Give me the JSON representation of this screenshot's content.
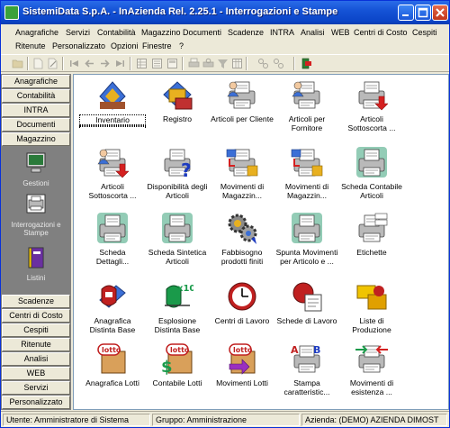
{
  "window": {
    "title": "SistemiData S.p.A. - InAzienda Rel. 2.25.1 - Interrogazioni e Stampe"
  },
  "menu": {
    "row1": [
      "Anagrafiche",
      "Servizi",
      "Contabilità",
      "Magazzino",
      "Documenti",
      "Scadenze",
      "INTRA",
      "Analisi",
      "WEB",
      "Centri di Costo",
      "Cespiti"
    ],
    "row2": [
      "Ritenute",
      "Personalizzato",
      "Opzioni",
      "Finestre",
      "?"
    ]
  },
  "sidebar": {
    "top_buttons": [
      "Anagrafiche",
      "Contabilità",
      "INTRA",
      "Documenti",
      "Magazzino"
    ],
    "items": [
      "Gestioni",
      "Interrogazioni e Stampe",
      "Listini"
    ],
    "bottom_buttons": [
      "Scadenze",
      "Centri di Costo",
      "Cespiti",
      "Ritenute",
      "Analisi",
      "WEB",
      "Servizi",
      "Personalizzato"
    ]
  },
  "items": [
    {
      "line1": "Inventario",
      "line2": "",
      "icon": "inventory-icon"
    },
    {
      "line1": "Registro",
      "line2": "",
      "icon": "register-icon"
    },
    {
      "line1": "Articoli per Cliente",
      "line2": "",
      "icon": "printer-person-icon"
    },
    {
      "line1": "Articoli per",
      "line2": "Fornitore",
      "icon": "printer-person-icon"
    },
    {
      "line1": "Articoli",
      "line2": "Sottoscorta ...",
      "icon": "printer-arrow-icon"
    },
    {
      "line1": "Articoli",
      "line2": "Sottoscorta ...",
      "icon": "printer-person-arrow-icon"
    },
    {
      "line1": "Disponibilità degli",
      "line2": "Articoli",
      "icon": "printer-question-icon"
    },
    {
      "line1": "Movimenti di",
      "line2": "Magazzin...",
      "icon": "printer-boxes-icon"
    },
    {
      "line1": "Movimenti di",
      "line2": "Magazzin...",
      "icon": "printer-boxes-icon"
    },
    {
      "line1": "Scheda Contabile",
      "line2": "Articoli",
      "icon": "printer-green-icon"
    },
    {
      "line1": "Scheda",
      "line2": "Dettagli...",
      "icon": "printer-green-icon"
    },
    {
      "line1": "Scheda Sintetica",
      "line2": "Articoli",
      "icon": "printer-green-icon"
    },
    {
      "line1": "Fabbisogno",
      "line2": "prodotti finiti",
      "icon": "gears-icon"
    },
    {
      "line1": "Spunta Movimenti",
      "line2": "per Articolo e ...",
      "icon": "printer-green-icon"
    },
    {
      "line1": "Etichette",
      "line2": "",
      "icon": "printer-labels-icon"
    },
    {
      "line1": "Anagrafica",
      "line2": "Distinta Base",
      "icon": "bom-icon"
    },
    {
      "line1": "Esplosione",
      "line2": "Distinta Base",
      "icon": "bom-explode-icon"
    },
    {
      "line1": "Centri di Lavoro",
      "line2": "",
      "icon": "clock-icon"
    },
    {
      "line1": "Schede di Lavoro",
      "line2": "",
      "icon": "workcard-icon"
    },
    {
      "line1": "Liste di",
      "line2": "Produzione",
      "icon": "production-icon"
    },
    {
      "line1": "Anagrafica Lotti",
      "line2": "",
      "icon": "lotto-icon"
    },
    {
      "line1": "Contabile Lotti",
      "line2": "",
      "icon": "lotto-money-icon"
    },
    {
      "line1": "Movimenti Lotti",
      "line2": "",
      "icon": "lotto-arrow-icon"
    },
    {
      "line1": "Stampa",
      "line2": "caratteristic...",
      "icon": "printer-letters-icon"
    },
    {
      "line1": "Movimenti di",
      "line2": "esistenza ...",
      "icon": "printer-arrows-icon"
    }
  ],
  "status": {
    "user": "Utente: Amministratore di Sistema",
    "group": "Gruppo: Amministrazione",
    "company": "Azienda: (DEMO) AZIENDA DIMOST"
  },
  "colors": {
    "title_bar": "#0b45c8",
    "sidebar_bg": "#808080",
    "accent_red": "#d42020",
    "accent_green": "#3aa27a"
  }
}
